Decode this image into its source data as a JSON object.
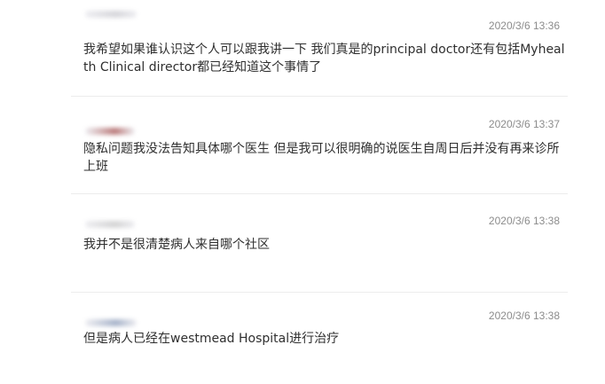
{
  "comments": [
    {
      "timestamp": "2020/3/6 13:36",
      "text": "我希望如果谁认识这个人可以跟我讲一下 我们真是的principal doctor还有包括Myhealth Clinical director都已经知道这个事情了",
      "avatar_color": "#c9c9cf"
    },
    {
      "timestamp": "2020/3/6 13:37",
      "text": "隐私问题我没法告知具体哪个医生 但是我可以很明确的说医生自周日后并没有再来诊所上班",
      "avatar_color": "#a45050"
    },
    {
      "timestamp": "2020/3/6 13:38",
      "text": "我并不是很清楚病人来自哪个社区",
      "avatar_color": "#c6c6c6"
    },
    {
      "timestamp": "2020/3/6 13:38",
      "text": "但是病人已经在westmead Hospital进行治疗",
      "avatar_color": "#8a9ab8"
    }
  ]
}
